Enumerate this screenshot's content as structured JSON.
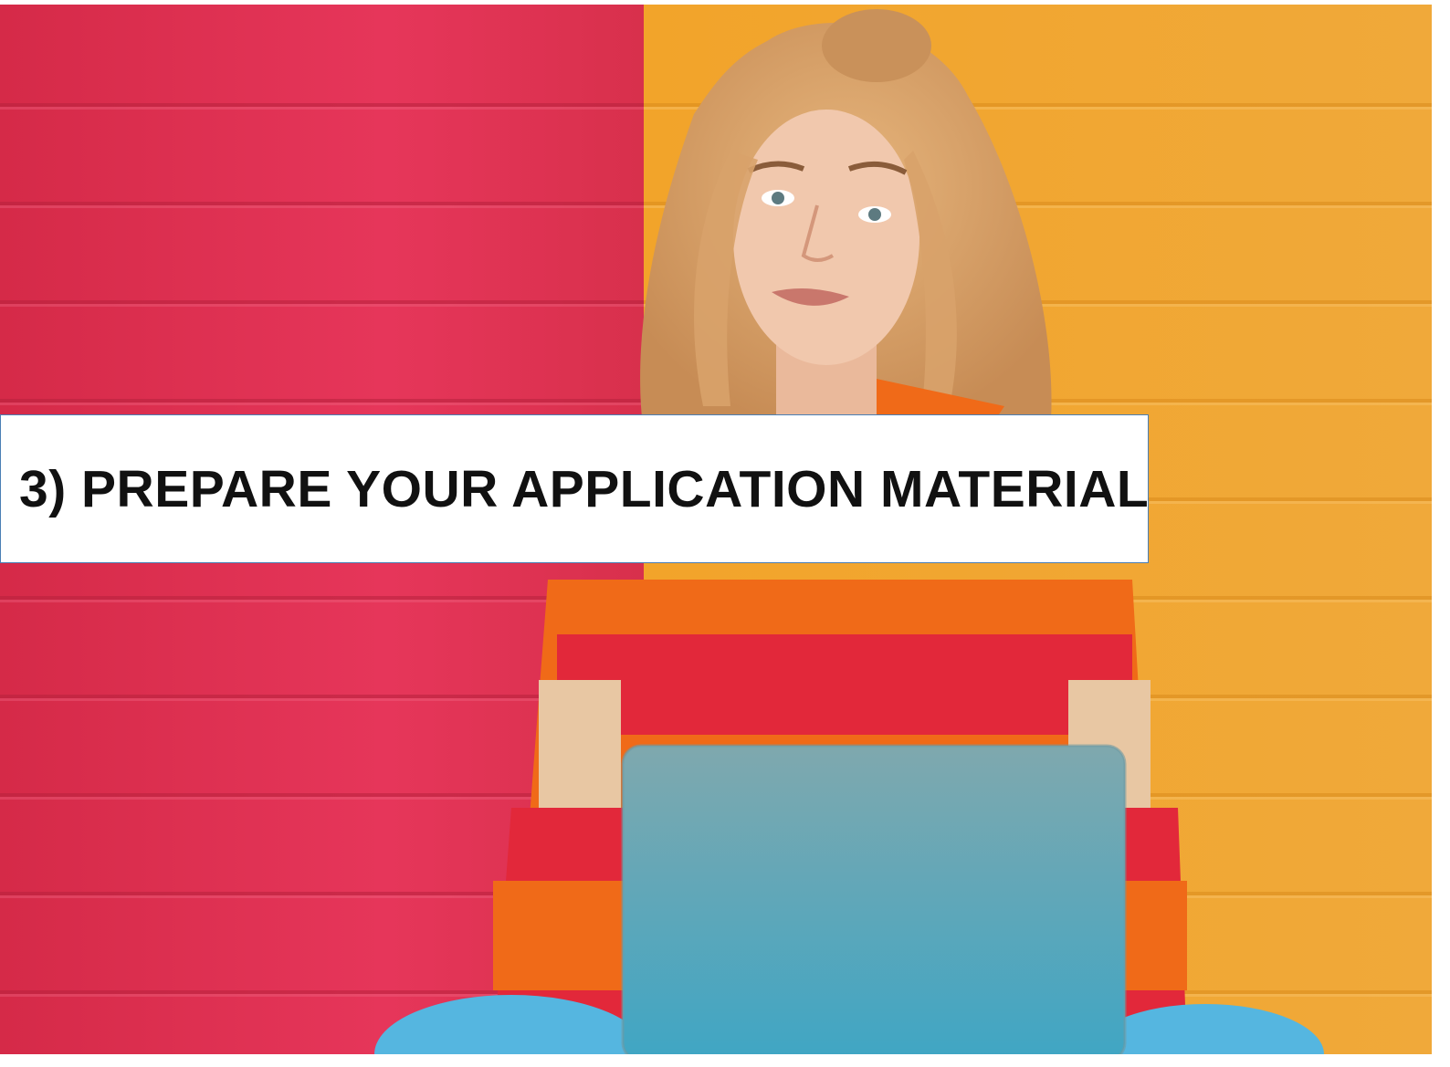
{
  "slide": {
    "title": "3) PREPARE YOUR APPLICATION MATERIAL"
  },
  "photo": {
    "subject": "woman-with-laptop-photo",
    "colors": {
      "left_wall": "#d9304f",
      "right_wall": "#f0a52c",
      "sweater_orange": "#f06a18",
      "sweater_red": "#e2283a",
      "sweater_beige": "#e8c7a3",
      "laptop": "#5aa3b0",
      "jeans": "#55b6e0",
      "hair": "#d9a36a",
      "skin": "#f1c8ad"
    }
  },
  "colors": {
    "title_box_background": "#ffffff",
    "title_box_border": "#4a7fb5",
    "title_text": "#111111"
  }
}
